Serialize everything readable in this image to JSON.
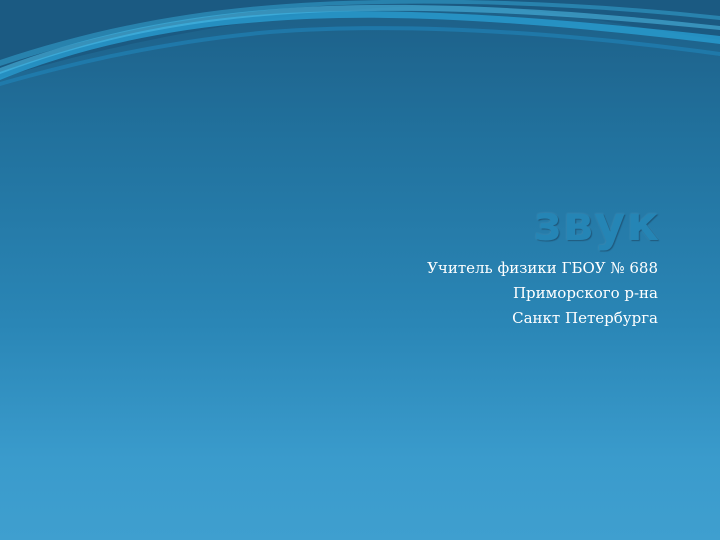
{
  "slide": {
    "title": "звук",
    "subtitle_lines": [
      "Учитель физики ГБОУ № 688",
      "Приморского р-на",
      "Санкт Петербурга"
    ]
  },
  "colors": {
    "background_top": "#1d5f87",
    "background_bottom": "#3f9fcf",
    "title": "#2585b5",
    "subtitle": "#ffffff",
    "wave": "#2aa2d6"
  }
}
